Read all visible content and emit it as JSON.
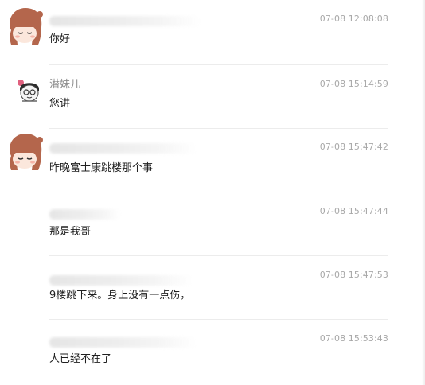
{
  "colors": {
    "timestamp": "#a8a8a8",
    "sender_name": "#8a8a8a",
    "divider": "#ececec",
    "avatar_hair": "#b4664c"
  },
  "messages": [
    {
      "sender": "",
      "sender_hidden": true,
      "avatar": "cartoon-girl-avatar",
      "time": "07-08 12:08:08",
      "text": "你好"
    },
    {
      "sender": "潜妹儿",
      "sender_hidden": false,
      "avatar": "cartoon-boy-glasses-avatar",
      "time": "07-08 15:14:59",
      "text": "您讲"
    },
    {
      "sender": "",
      "sender_hidden": true,
      "avatar": "cartoon-girl-avatar",
      "time": "07-08 15:47:42",
      "text": "昨晚富士康跳楼那个事"
    },
    {
      "sender": "",
      "sender_hidden": true,
      "avatar": "",
      "time": "07-08 15:47:44",
      "text": "那是我哥"
    },
    {
      "sender": "",
      "sender_hidden": true,
      "avatar": "",
      "time": "07-08 15:47:53",
      "text": "9楼跳下来。身上没有一点伤，"
    },
    {
      "sender": "",
      "sender_hidden": true,
      "avatar": "",
      "time": "07-08 15:53:43",
      "text": "人已经不在了"
    }
  ]
}
